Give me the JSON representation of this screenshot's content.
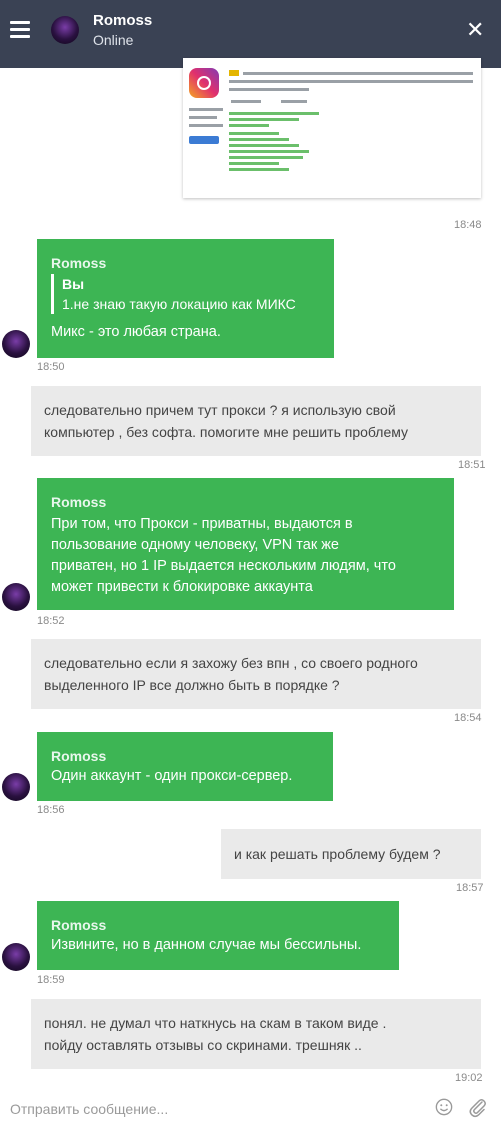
{
  "header": {
    "contact_name": "Romoss",
    "status": "Online"
  },
  "messages": [
    {
      "type": "image",
      "time": "18:48"
    },
    {
      "type": "incoming",
      "author": "Romoss",
      "quote_author": "Вы",
      "quote_text": "1.не знаю такую локацию как МИКС",
      "text": "Микс - это любая страна.",
      "time": "18:50"
    },
    {
      "type": "outgoing",
      "lines": [
        "следовательно причем тут прокси ? я использую свой",
        "компьютер , без софта. помогите мне решить проблему"
      ],
      "time": "18:51"
    },
    {
      "type": "incoming",
      "author": "Romoss",
      "lines": [
        "При том, что Прокси - приватны, выдаются в",
        "пользование одному человеку, VPN так же",
        "приватен, но 1 IP выдается нескольким людям, что",
        "может привести к блокировке аккаунта"
      ],
      "time": "18:52"
    },
    {
      "type": "outgoing",
      "lines": [
        "следовательно если я захожу без впн , со своего родного",
        "выделенного IP все должно быть в порядке ?"
      ],
      "time": "18:54"
    },
    {
      "type": "incoming",
      "author": "Romoss",
      "text": "Один аккаунт - один прокси-сервер.",
      "time": "18:56"
    },
    {
      "type": "outgoing",
      "lines": [
        "и как решать проблему будем ?"
      ],
      "time": "18:57"
    },
    {
      "type": "incoming",
      "author": "Romoss",
      "text": "Извините, но в данном случае мы бессильны.",
      "time": "18:59"
    },
    {
      "type": "outgoing",
      "lines": [
        "понял. не думал что наткнусь на скам в таком виде .",
        "пойду оставлять отзывы со скринами. трешняк .."
      ],
      "time": "19:02"
    }
  ],
  "composer": {
    "placeholder": "Отправить сообщение..."
  }
}
